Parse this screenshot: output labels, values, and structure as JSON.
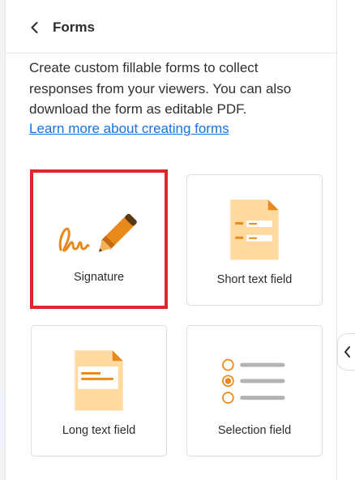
{
  "header": {
    "title": "Forms"
  },
  "intro": {
    "description": "Create custom fillable forms to collect responses from your viewers. You can also download the form as editable PDF.",
    "learn_more": "Learn more about creating forms"
  },
  "cards": [
    {
      "label": "Signature",
      "icon": "signature-pen-icon",
      "selected": true
    },
    {
      "label": "Short text field",
      "icon": "short-text-document-icon",
      "selected": false
    },
    {
      "label": "Long text field",
      "icon": "long-text-document-icon",
      "selected": false
    },
    {
      "label": "Selection field",
      "icon": "radio-list-icon",
      "selected": false
    }
  ],
  "colors": {
    "accent_orange": "#e8891b",
    "doc_fill": "#ffd9a0",
    "selection_outline": "#e0262b",
    "link": "#1473e6"
  }
}
